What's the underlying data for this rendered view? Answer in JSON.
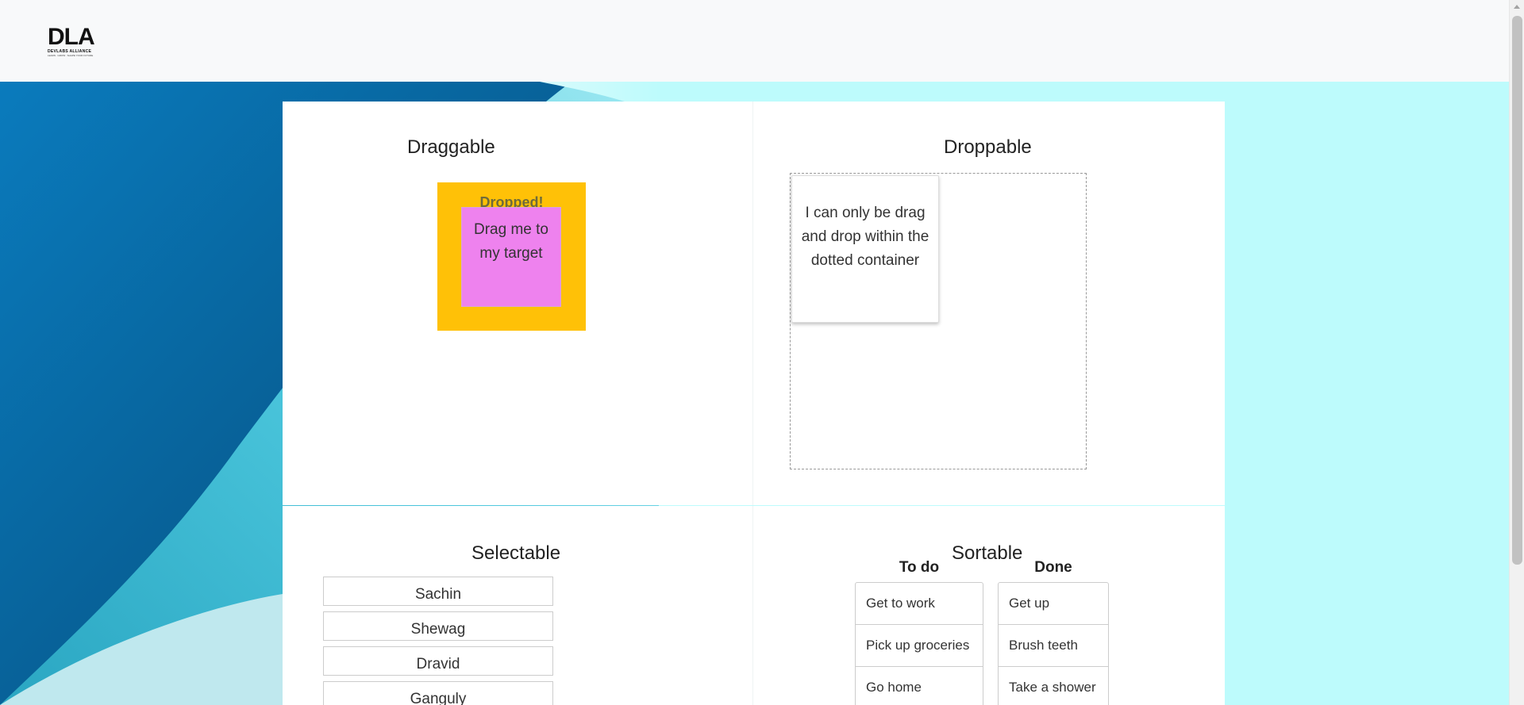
{
  "header": {
    "logo": {
      "mark": "DLA",
      "company": "DEVLABS ALLIANCE",
      "tagline": "LEARN . GROW . SHAPE YOUR FUTURE"
    }
  },
  "colors": {
    "header_bg": "#f8f9fa",
    "page_bg": "#bdfbfc",
    "drop_target": "#ffc107",
    "drag_box": "#ee82ee",
    "wave_dark": "#0a6ea8",
    "wave_light": "#5bcfe0"
  },
  "draggable": {
    "title": "Draggable",
    "target_label": "Dropped!",
    "drag_label": "Drag me to my target"
  },
  "droppable": {
    "title": "Droppable",
    "box_label": "I can only be drag and drop within the dotted container"
  },
  "selectable": {
    "title": "Selectable",
    "items": [
      "Sachin",
      "Shewag",
      "Dravid",
      "Ganguly"
    ]
  },
  "sortable": {
    "title": "Sortable",
    "columns": [
      {
        "title": "To do",
        "items": [
          "Get to work",
          "Pick up groceries",
          "Go home"
        ]
      },
      {
        "title": "Done",
        "items": [
          "Get up",
          "Brush teeth",
          "Take a shower"
        ]
      }
    ]
  }
}
